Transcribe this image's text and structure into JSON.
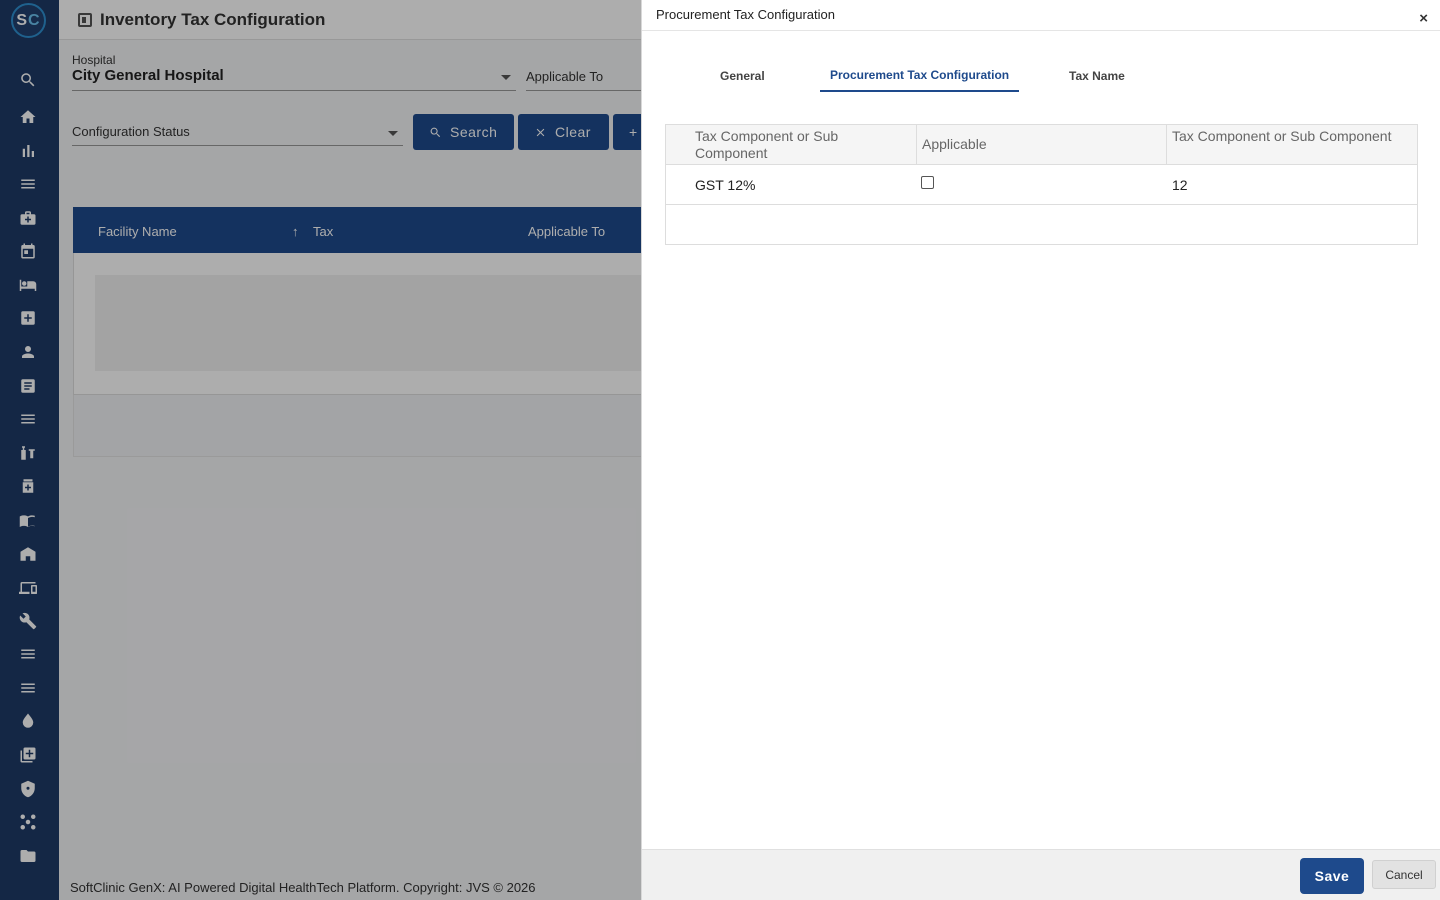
{
  "app": {
    "logo_letters": "SC",
    "logo_first": "S",
    "logo_second": "C",
    "page_title": "Inventory Tax Configuration",
    "footer": "SoftClinic GenX: AI Powered Digital HealthTech Platform. Copyright: JVS © 2026"
  },
  "sidebar": {
    "icons": [
      "search-icon",
      "home-icon",
      "bar-chart-icon",
      "menu-icon",
      "medical-bag-icon",
      "calendar-icon",
      "bed-icon",
      "hospital-plus-icon",
      "person-icon",
      "document-icon",
      "menu-icon",
      "syringe-icon",
      "medicine-icon",
      "book-icon",
      "building-icon",
      "devices-icon",
      "wrench-icon",
      "menu-icon",
      "menu-icon",
      "drop-icon",
      "library-add-icon",
      "shield-icon",
      "hub-icon",
      "folder-icon"
    ]
  },
  "filters": {
    "hospital_label": "Hospital",
    "hospital_value": "City General Hospital",
    "applicable_to_placeholder": "Applicable To",
    "config_status_placeholder": "Configuration Status",
    "search_label": "Search",
    "clear_label": "Clear",
    "add_label": "+"
  },
  "grid": {
    "columns": [
      "Facility Name",
      "Tax",
      "Applicable To"
    ]
  },
  "drawer": {
    "title": "Procurement Tax Configuration",
    "close": "×",
    "tabs": [
      {
        "label": "General",
        "active": false
      },
      {
        "label": "Procurement Tax Configuration",
        "active": true
      },
      {
        "label": "Tax Name",
        "active": false
      }
    ],
    "table": {
      "headers": [
        "Tax Component or Sub Component",
        "Applicable",
        "Tax Component or Sub Component"
      ],
      "rows": [
        {
          "component": "GST 12%",
          "applicable": false,
          "value": "12"
        }
      ]
    },
    "save_label": "Save",
    "cancel_label": "Cancel"
  },
  "colors": {
    "primary": "#1e4a8c",
    "sidebar": "#1e3a66",
    "logo_accent": "#6cc3f0"
  }
}
